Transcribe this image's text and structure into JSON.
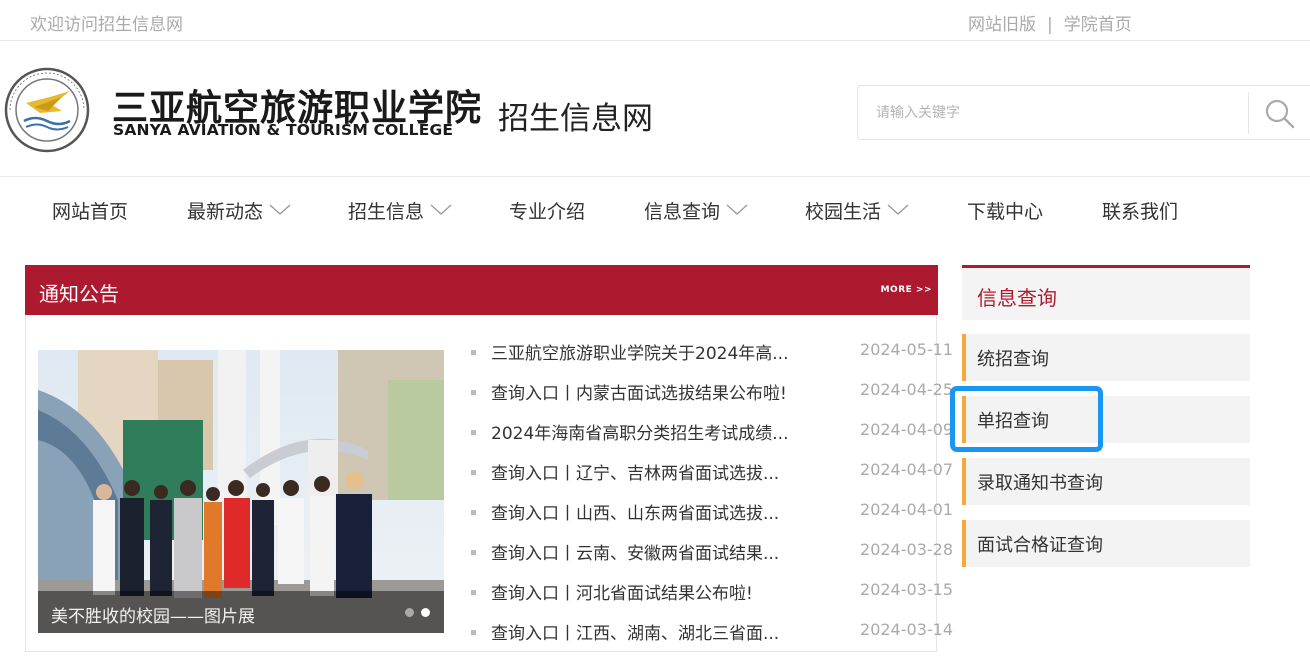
{
  "topbar": {
    "welcome": "欢迎访问招生信息网",
    "links": [
      "网站旧版",
      "学院首页"
    ],
    "separator": "|"
  },
  "header": {
    "logo_cn": "三亚航空旅游职业学院",
    "logo_en": "SANYA AVIATION & TOURISM COLLEGE",
    "site_name": "招生信息网",
    "search_placeholder": "请输入关键字"
  },
  "nav": [
    {
      "label": "网站首页",
      "dropdown": false
    },
    {
      "label": "最新动态",
      "dropdown": true
    },
    {
      "label": "招生信息",
      "dropdown": true
    },
    {
      "label": "专业介绍",
      "dropdown": false
    },
    {
      "label": "信息查询",
      "dropdown": true
    },
    {
      "label": "校园生活",
      "dropdown": true
    },
    {
      "label": "下载中心",
      "dropdown": false
    },
    {
      "label": "联系我们",
      "dropdown": false
    }
  ],
  "notice": {
    "title": "通知公告",
    "more": "MORE >>",
    "photo_caption": "美不胜收的校园——图片展",
    "items": [
      {
        "title": "三亚航空旅游职业学院关于2024年高...",
        "date": "2024-05-11"
      },
      {
        "title": "查询入口丨内蒙古面试选拔结果公布啦!",
        "date": "2024-04-25"
      },
      {
        "title": "2024年海南省高职分类招生考试成绩...",
        "date": "2024-04-09"
      },
      {
        "title": "查询入口丨辽宁、吉林两省面试选拔...",
        "date": "2024-04-07"
      },
      {
        "title": "查询入口丨山西、山东两省面试选拔...",
        "date": "2024-04-01"
      },
      {
        "title": "查询入口丨云南、安徽两省面试结果...",
        "date": "2024-03-28"
      },
      {
        "title": "查询入口丨河北省面试结果公布啦!",
        "date": "2024-03-15"
      },
      {
        "title": "查询入口丨江西、湖南、湖北三省面...",
        "date": "2024-03-14"
      }
    ]
  },
  "sidebar": {
    "title": "信息查询",
    "items": [
      "统招查询",
      "单招查询",
      "录取通知书查询",
      "面试合格证查询"
    ],
    "highlighted_item": "单招查询"
  },
  "colors": {
    "brand_red": "#ad1a30",
    "accent_orange": "#f4a93a",
    "highlight_blue": "#1b96f0"
  }
}
